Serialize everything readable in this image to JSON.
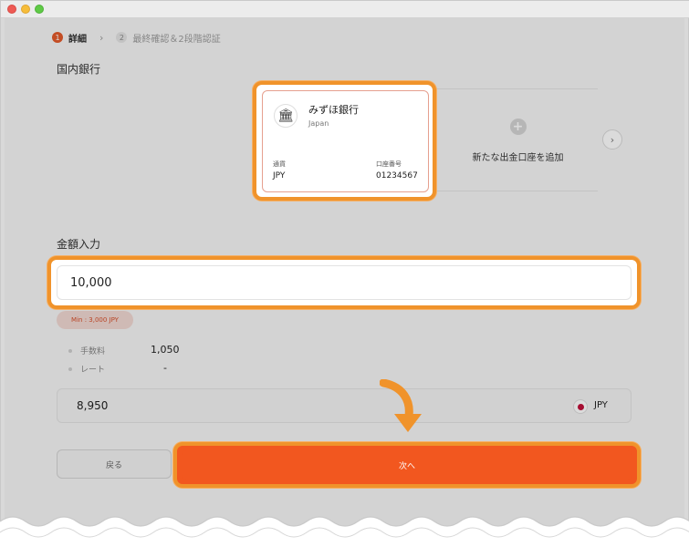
{
  "stepper": {
    "steps": [
      {
        "num": "1",
        "label": "詳細"
      },
      {
        "num": "2",
        "label": "最終確認＆2段階認証"
      }
    ],
    "separator": "›"
  },
  "bank_section": {
    "title": "国内銀行",
    "card": {
      "bank_name": "みずほ銀行",
      "country": "Japan",
      "currency_label": "通貨",
      "currency_value": "JPY",
      "account_label": "口座番号",
      "account_value": "01234567"
    },
    "add_label": "新たな出金口座を追加",
    "add_icon": "plus-icon",
    "next_icon": "chevron-right-icon"
  },
  "amount_section": {
    "title": "金額入力",
    "value": "10,000",
    "min_badge": "Min : 3,000 JPY",
    "fee_label": "手数料",
    "fee_value": "1,050",
    "rate_label": "レート",
    "rate_value": "-",
    "result_value": "8,950",
    "result_currency": "JPY"
  },
  "actions": {
    "back_label": "戻る",
    "next_label": "次へ"
  },
  "colors": {
    "accent": "#f2571f",
    "highlight": "#f0932b"
  }
}
